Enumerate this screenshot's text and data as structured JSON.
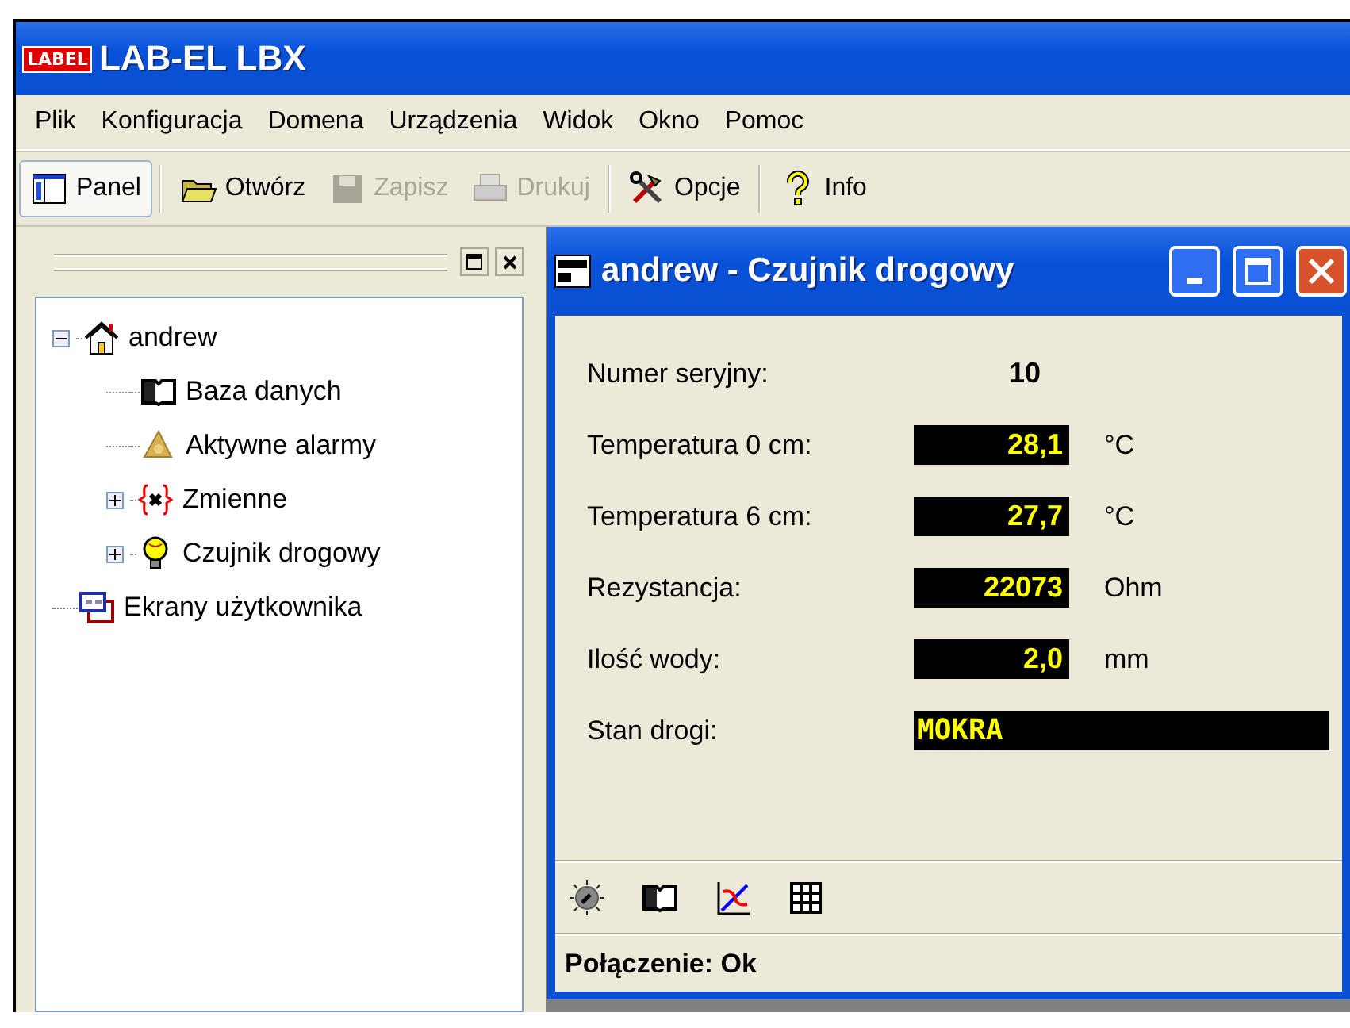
{
  "app": {
    "logo": "LABEL",
    "title": "LAB-EL LBX"
  },
  "menu": [
    "Plik",
    "Konfiguracja",
    "Domena",
    "Urządzenia",
    "Widok",
    "Okno",
    "Pomoc"
  ],
  "toolbar": [
    [
      {
        "label": "Panel",
        "disabled": false,
        "pressed": true
      }
    ],
    [
      {
        "label": "Otwórz",
        "disabled": false,
        "pressed": false
      },
      {
        "label": "Zapisz",
        "disabled": true,
        "pressed": false
      },
      {
        "label": "Drukuj",
        "disabled": true,
        "pressed": false
      }
    ],
    [
      {
        "label": "Opcje",
        "disabled": false,
        "pressed": false
      }
    ],
    [
      {
        "label": "Info",
        "disabled": false,
        "pressed": false
      }
    ]
  ],
  "tree": [
    {
      "label": "andrew",
      "expanded": true,
      "children": [
        {
          "label": "Baza danych"
        },
        {
          "label": "Aktywne alarmy"
        },
        {
          "label": "Zmienne",
          "expanded": false
        },
        {
          "label": "Czujnik drogowy",
          "expanded": false
        }
      ]
    },
    {
      "label": "Ekrany użytkownika"
    }
  ],
  "child_window": {
    "title": "andrew - Czujnik drogowy",
    "fields": [
      {
        "kind": "plain",
        "label": "Numer seryjny:",
        "value": "10"
      },
      {
        "kind": "display",
        "label": "Temperatura 0 cm:",
        "value": "28,1",
        "unit": "°C"
      },
      {
        "kind": "display",
        "label": "Temperatura 6 cm:",
        "value": "27,7",
        "unit": "°C"
      },
      {
        "kind": "display",
        "label": "Rezystancja:",
        "value": "22073",
        "unit": "Ohm"
      },
      {
        "kind": "display",
        "label": "Ilość wody:",
        "value": "2,0",
        "unit": "mm"
      },
      {
        "kind": "wide",
        "label": "Stan drogi:",
        "value": "MOKRA"
      }
    ],
    "status": "Połączenie: Ok"
  }
}
